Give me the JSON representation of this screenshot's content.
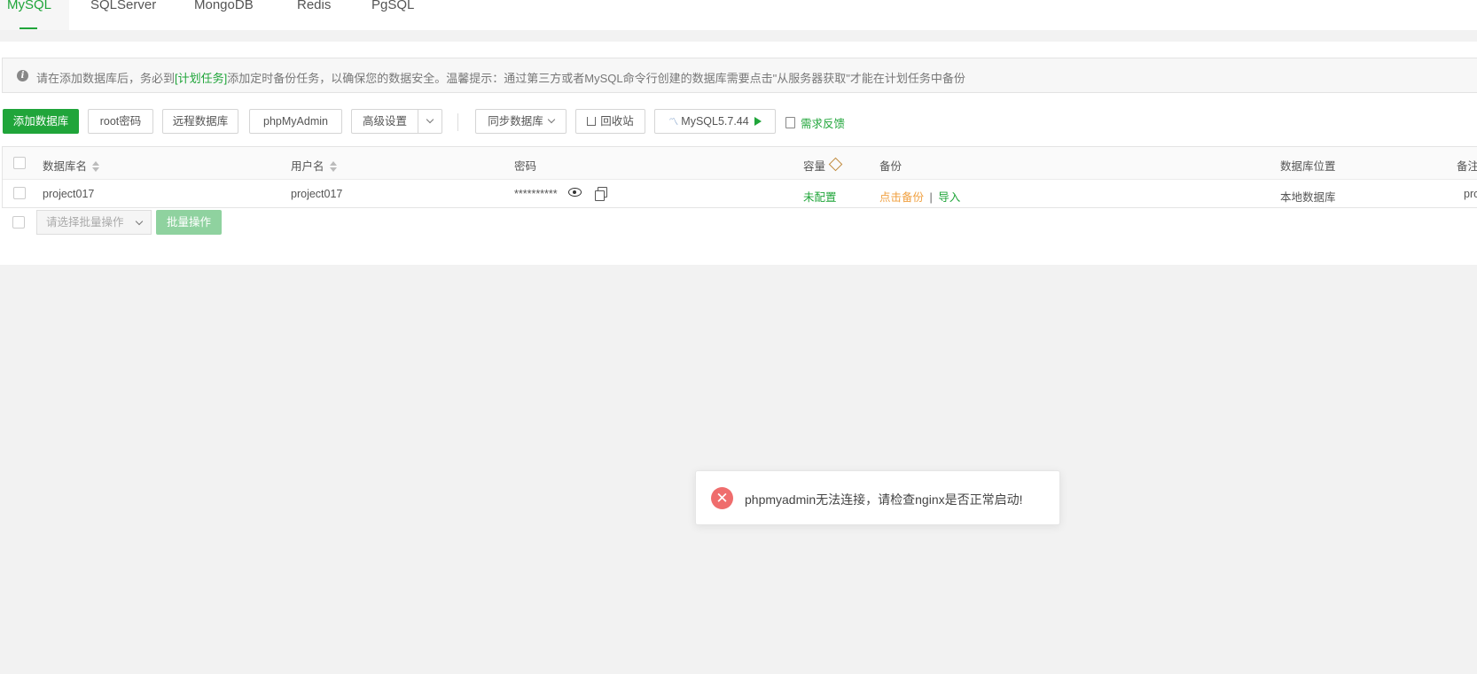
{
  "tabs": [
    {
      "label": "MySQL",
      "active": true
    },
    {
      "label": "SQLServer"
    },
    {
      "label": "MongoDB"
    },
    {
      "label": "Redis"
    },
    {
      "label": "PgSQL"
    }
  ],
  "notice": {
    "prefix": "请在添加数据库后，务必到",
    "link": "[计划任务]",
    "suffix": "添加定时备份任务，以确保您的数据安全。温馨提示：通过第三方或者MySQL命令行创建的数据库需要点击\"从服务器获取\"才能在计划任务中备份"
  },
  "toolbar": {
    "add_db": "添加数据库",
    "root_pwd": "root密码",
    "remote_db": "远程数据库",
    "phpmyadmin": "phpMyAdmin",
    "advanced": "高级设置",
    "sync_db": "同步数据库",
    "recycle": "回收站",
    "mysql_version": "MySQL5.7.44",
    "feedback": "需求反馈"
  },
  "table": {
    "headers": {
      "name": "数据库名",
      "user": "用户名",
      "password": "密码",
      "capacity": "容量",
      "backup": "备份",
      "location": "数据库位置",
      "remark": "备注"
    },
    "rows": [
      {
        "name": "project017",
        "user": "project017",
        "password": "**********",
        "capacity": "未配置",
        "backup_action": "点击备份",
        "separator": "|",
        "import_action": "导入",
        "location": "本地数据库",
        "remark": "pro"
      }
    ]
  },
  "batch": {
    "placeholder": "请选择批量操作",
    "button": "批量操作"
  },
  "toast": {
    "message": "phpmyadmin无法连接，请检查nginx是否正常启动!"
  },
  "colors": {
    "accent": "#20a53a",
    "warning": "#f0a040",
    "error": "#ef6d6d"
  }
}
